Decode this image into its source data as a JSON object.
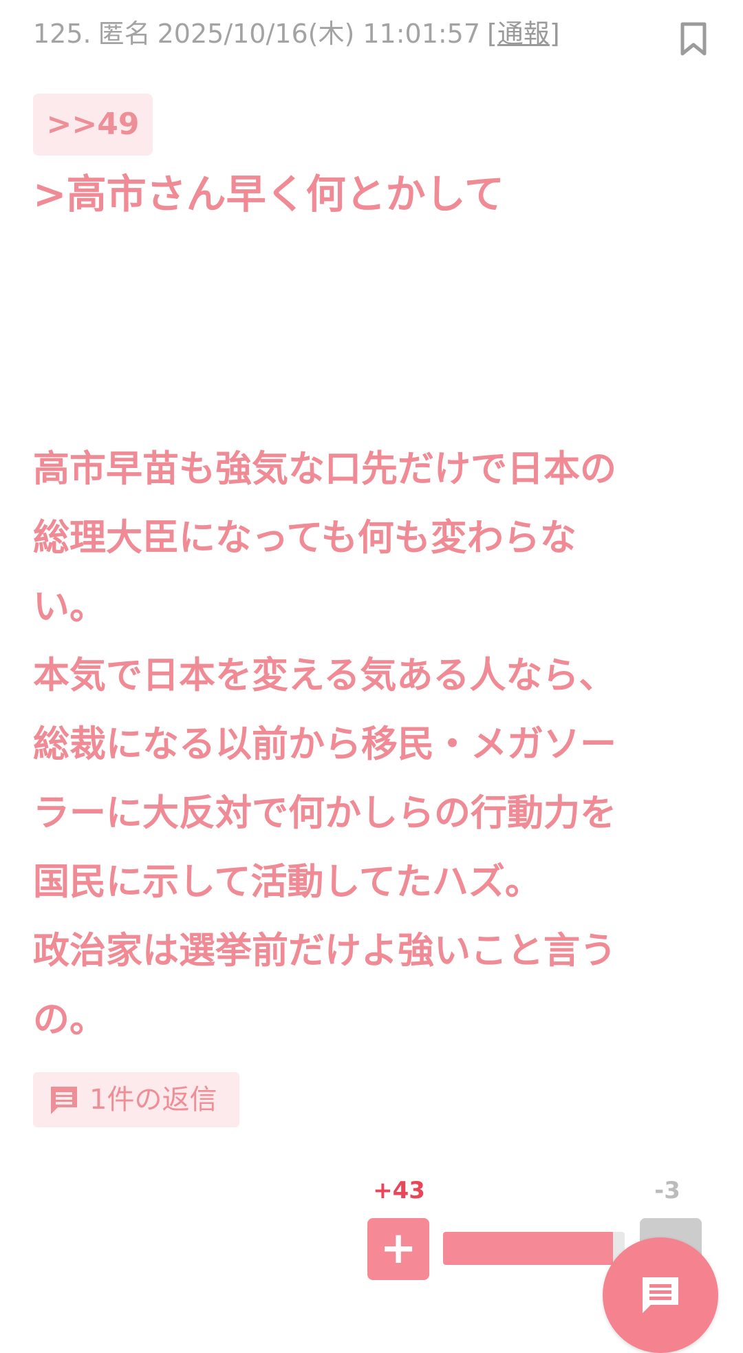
{
  "post": {
    "number": "125.",
    "author": "匿名",
    "datetime": "2025/10/16(木) 11:01:57",
    "report_open": "[",
    "report_label": "通報",
    "report_close": "]"
  },
  "anchor": {
    "label": ">>49"
  },
  "quote": {
    "text": ">高市さん早く何とかして"
  },
  "body": {
    "lines": [
      "高市早苗も強気な口先だけで日本の",
      "総理大臣になっても何も変わらな",
      "い。",
      "本気で日本を変える気ある人なら、",
      "総裁になる以前から移民・メガソー",
      "ラーに大反対で何かしらの行動力を",
      "国民に示して活動してたハズ。",
      "政治家は選挙前だけよ強いこと言う",
      "の。"
    ]
  },
  "replies": {
    "label": "1件の返信",
    "icon": "comment-icon"
  },
  "votes": {
    "plus_count": "+43",
    "minus_count": "-3",
    "plus_label": "+",
    "plus_share": 0.935
  },
  "colors": {
    "accent": "#f08a94",
    "accent_bg": "#fdeaec",
    "plus": "#e8475a",
    "meta": "#a3a3a3"
  },
  "icons": {
    "bookmark": "bookmark-icon",
    "reply": "comment-icon",
    "fab": "comment-icon"
  }
}
